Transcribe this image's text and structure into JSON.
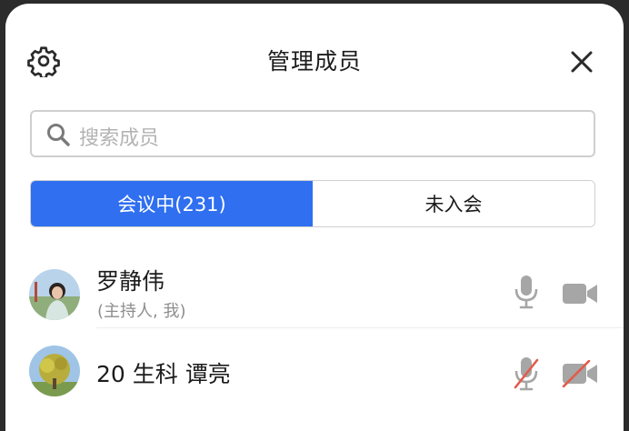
{
  "dialog": {
    "title": "管理成员",
    "settings_icon": "gear-icon",
    "close_icon": "close-icon"
  },
  "search": {
    "placeholder": "搜索成员",
    "icon": "search-icon"
  },
  "tabs": [
    {
      "label": "会议中(231)",
      "active": true
    },
    {
      "label": "未入会",
      "active": false
    }
  ],
  "members": [
    {
      "name": "罗静伟",
      "role": "(主持人, 我)",
      "mic_muted": false,
      "camera_off": false
    },
    {
      "name": "20 生科 谭亮",
      "role": "",
      "mic_muted": true,
      "camera_off": true
    }
  ],
  "colors": {
    "accent": "#2f6ff0",
    "icon_gray": "#a6a6a6",
    "muted_red": "#e25b4a"
  }
}
